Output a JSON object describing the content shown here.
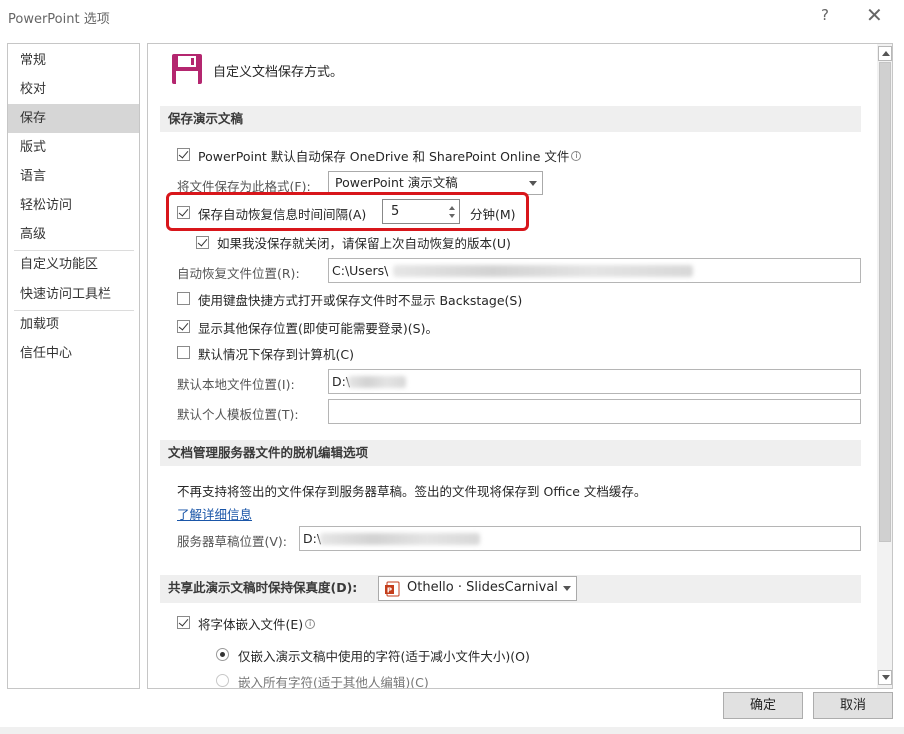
{
  "window": {
    "title": "PowerPoint 选项",
    "help": "?",
    "close": "✕"
  },
  "nav": {
    "items": [
      "常规",
      "校对",
      "保存",
      "版式",
      "语言",
      "轻松访问",
      "高级",
      "自定义功能区",
      "快速访问工具栏",
      "加载项",
      "信任中心"
    ],
    "active": "保存"
  },
  "header": {
    "icon": "save-floppy-icon",
    "text": "自定义文档保存方式。"
  },
  "save_presentations": {
    "title": "保存演示文稿",
    "autosave_label": "PowerPoint 默认自动保存 OneDrive 和 SharePoint Online 文件",
    "autosave_checked": true,
    "format_label": "将文件保存为此格式(F):",
    "format_value": "PowerPoint 演示文稿",
    "autorecover_label": "保存自动恢复信息时间间隔(A)",
    "autorecover_checked": true,
    "autorecover_minutes": "5",
    "minutes_label": "分钟(M)",
    "keep_last_label": "如果我没保存就关闭，请保留上次自动恢复的版本(U)",
    "keep_last_checked": true,
    "autorecover_path_label": "自动恢复文件位置(R):",
    "autorecover_path_value": "C:\\Users\\",
    "no_backstage_label": "使用键盘快捷方式打开或保存文件时不显示 Backstage(S)",
    "no_backstage_checked": false,
    "show_additional_label": "显示其他保存位置(即使可能需要登录)(S)。",
    "show_additional_checked": true,
    "save_local_label": "默认情况下保存到计算机(C)",
    "save_local_checked": false,
    "default_local_label": "默认本地文件位置(I):",
    "default_local_value": "D:\\",
    "default_template_label": "默认个人模板位置(T):",
    "default_template_value": ""
  },
  "offline_editing": {
    "title": "文档管理服务器文件的脱机编辑选项",
    "notice": "不再支持将签出的文件保存到服务器草稿。签出的文件现将保存到 Office 文档缓存。",
    "learn_more": "了解详细信息",
    "drafts_label": "服务器草稿位置(V):",
    "drafts_value": "D:\\"
  },
  "fidelity": {
    "title": "共享此演示文稿时保持保真度(D):",
    "presentation": "Othello · SlidesCarnival",
    "embed_fonts_label": "将字体嵌入文件(E)",
    "embed_fonts_checked": true,
    "embed_used_label": "仅嵌入演示文稿中使用的字符(适于减小文件大小)(O)",
    "embed_used_selected": true,
    "embed_all_label": "嵌入所有字符(适于其他人编辑)(C)"
  },
  "buttons": {
    "ok": "确定",
    "cancel": "取消"
  },
  "colors": {
    "highlight": "#d8161b",
    "save_icon": "#b4266f",
    "link": "#1a56a8",
    "active_nav": "#d6d6d6"
  }
}
